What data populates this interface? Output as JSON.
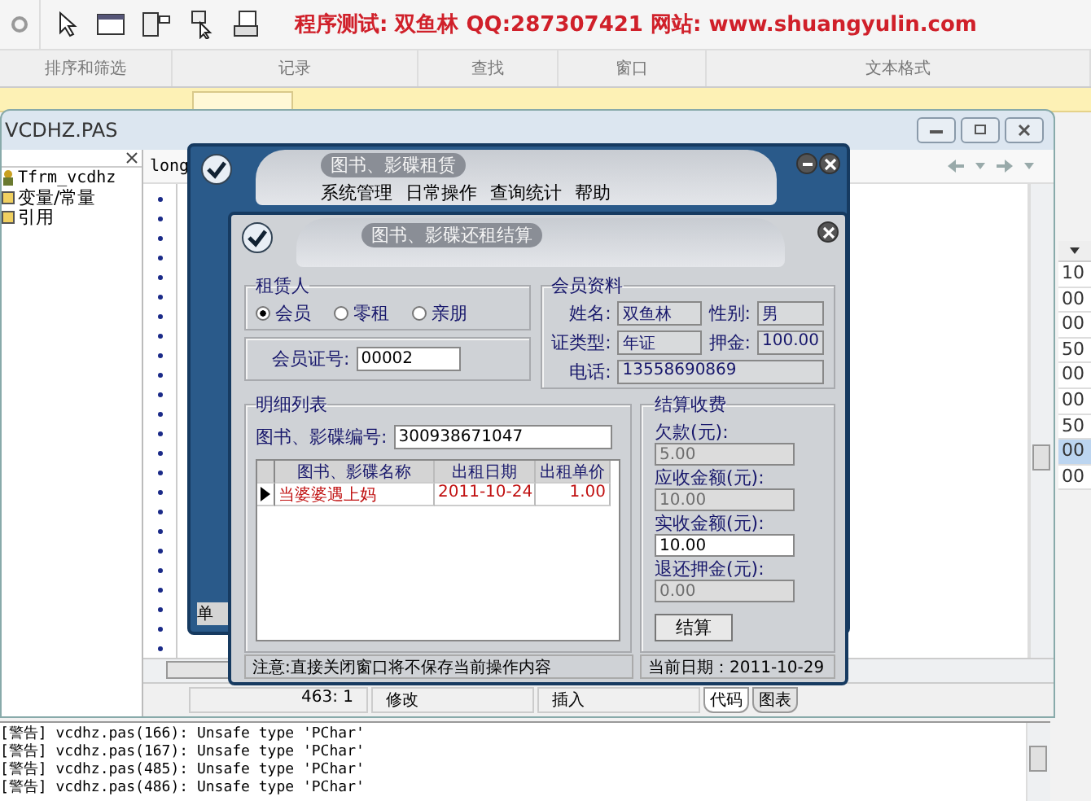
{
  "toolbar": {
    "banner": "程序测试: 双鱼林 QQ:287307421  网站: www.shuangyulin.com"
  },
  "ribbon_groups": [
    "排序和筛选",
    "记录",
    "查找",
    "窗口",
    "文本格式"
  ],
  "sheet_column": [
    {
      "text": "10",
      "selected": false
    },
    {
      "text": "00",
      "selected": false
    },
    {
      "text": "00",
      "selected": false
    },
    {
      "text": "50",
      "selected": false
    },
    {
      "text": "00",
      "selected": false
    },
    {
      "text": "00",
      "selected": false
    },
    {
      "text": "50",
      "selected": false
    },
    {
      "text": "00",
      "selected": true
    },
    {
      "text": "00",
      "selected": false
    }
  ],
  "ide": {
    "title": "VCDHZ.PAS",
    "tree": [
      {
        "label": "Tfrm_vcdhz",
        "kind": "class"
      },
      {
        "label": "变量/常量",
        "kind": "folder"
      },
      {
        "label": "引用",
        "kind": "folder"
      }
    ],
    "editor_text": "long",
    "status": {
      "position": "463:  1",
      "modified": "修改",
      "mode": "插入"
    },
    "view_tabs": [
      {
        "label": "代码",
        "selected": true
      },
      {
        "label": "图表",
        "selected": false
      }
    ],
    "messages": [
      "[警告] vcdhz.pas(166): Unsafe type 'PChar'",
      "[警告] vcdhz.pas(167): Unsafe type 'PChar'",
      "[警告] vcdhz.pas(485): Unsafe type 'PChar'",
      "[警告] vcdhz.pas(486): Unsafe type 'PChar'"
    ]
  },
  "main_window": {
    "title": "图书、影碟租赁",
    "menu": [
      "系统管理",
      "日常操作",
      "查询统计",
      "帮助"
    ],
    "footer_label": "单"
  },
  "dialog": {
    "title": "图书、影碟还租结算",
    "renter": {
      "legend": "租赁人",
      "options": [
        {
          "label": "会员",
          "selected": true
        },
        {
          "label": "零租",
          "selected": false
        },
        {
          "label": "亲朋",
          "selected": false
        }
      ]
    },
    "card_no": {
      "label": "会员证号:",
      "value": "00002"
    },
    "member": {
      "legend": "会员资料",
      "name_label": "姓名:",
      "name": "双鱼林",
      "gender_label": "性别:",
      "gender": "男",
      "id_type_label": "证类型:",
      "id_type": "年证",
      "deposit_label": "押金:",
      "deposit": "100.00",
      "phone_label": "电话:",
      "phone": "13558690869"
    },
    "detail": {
      "legend": "明细列表",
      "code_label": "图书、影碟编号:",
      "code": "300938671047",
      "columns": [
        "图书、影碟名称",
        "出租日期",
        "出租单价"
      ],
      "rows": [
        {
          "cells": [
            "当婆婆遇上妈",
            "2011-10-24",
            "1.00"
          ],
          "selected": true
        }
      ]
    },
    "settle": {
      "legend": "结算收费",
      "fields": [
        {
          "label": "欠款(元):",
          "value": "5.00",
          "disabled": true
        },
        {
          "label": "应收金额(元):",
          "value": "10.00",
          "disabled": true
        },
        {
          "label": "实收金额(元):",
          "value": "10.00",
          "disabled": false
        },
        {
          "label": "退还押金(元):",
          "value": "0.00",
          "disabled": true
        }
      ],
      "button": "结算"
    },
    "status": {
      "note": "注意:直接关闭窗口将不保存当前操作内容",
      "date": "当前日期：2011-10-29"
    }
  }
}
